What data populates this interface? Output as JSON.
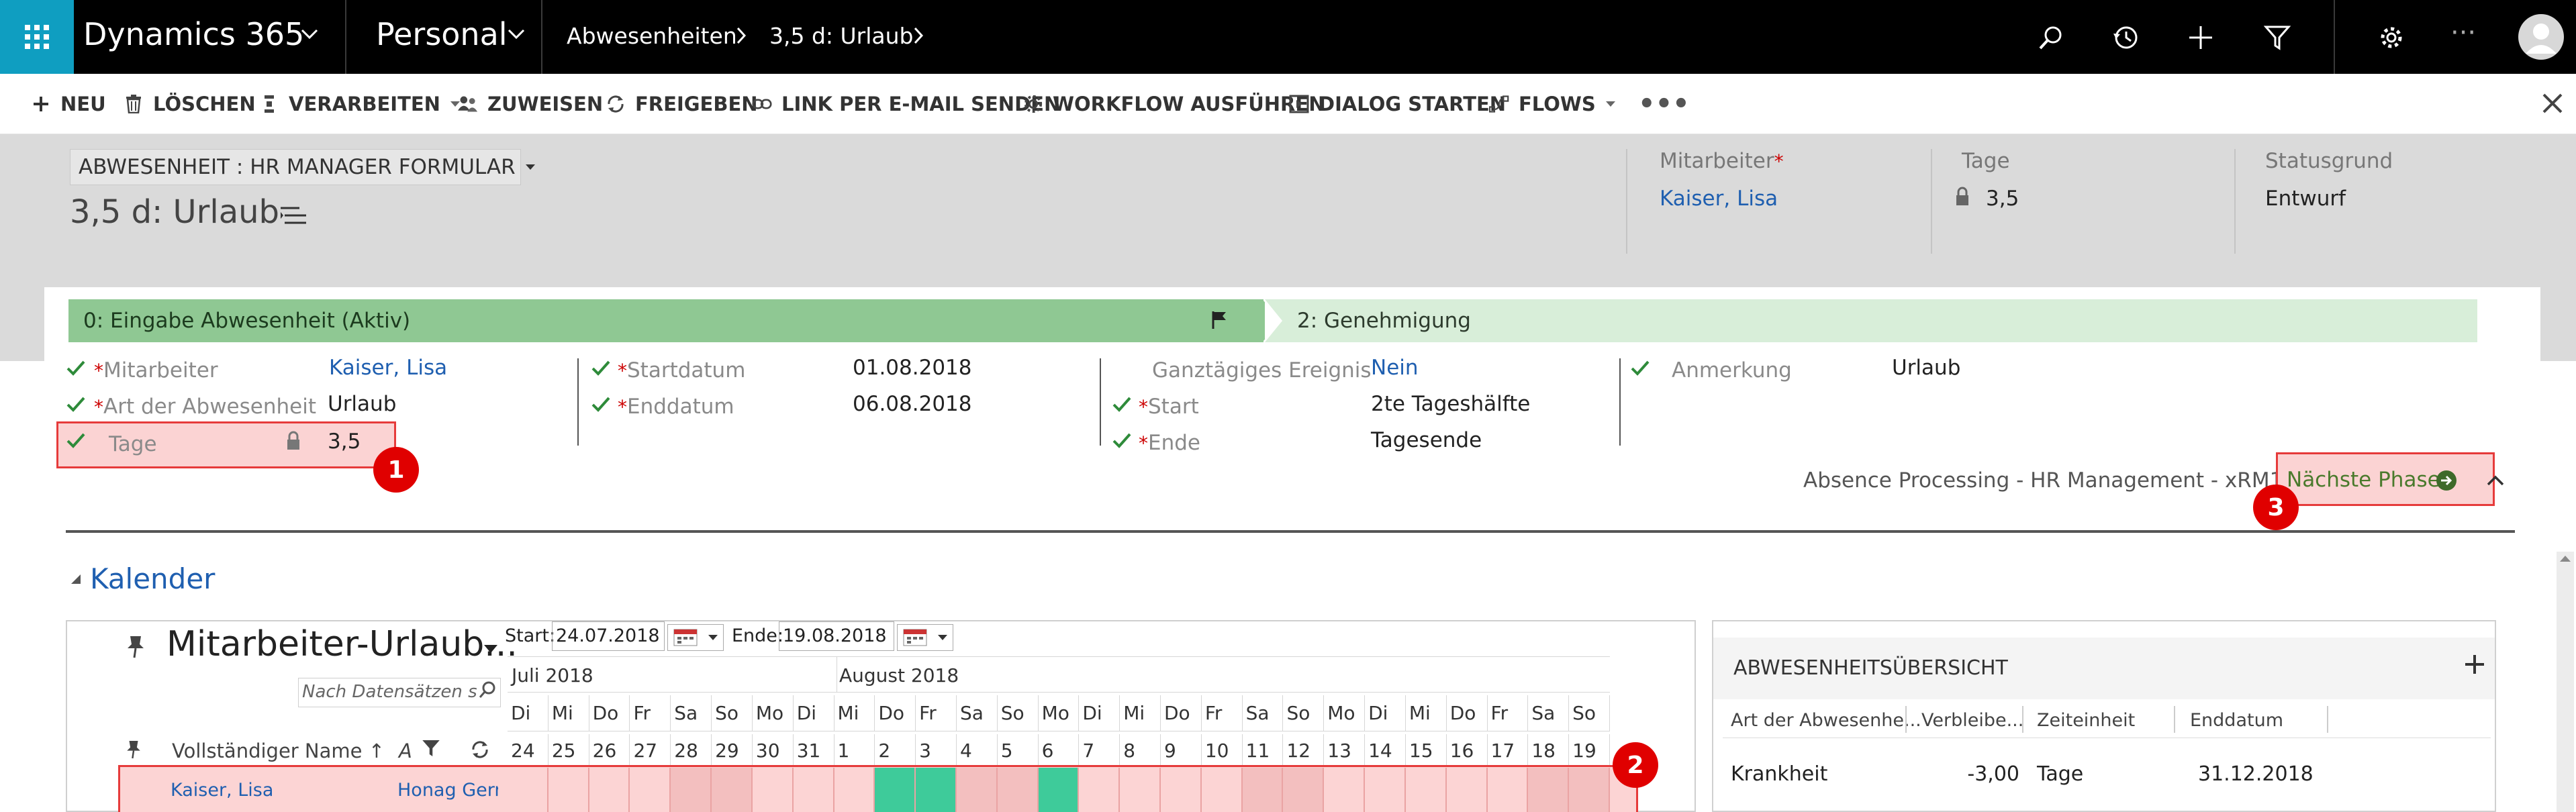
{
  "nav": {
    "app_name": "Dynamics 365",
    "area": "Personal",
    "breadcrumb": [
      "Abwesenheiten",
      "3,5 d: Urlaub"
    ],
    "icons": [
      "waffle-icon",
      "chevron-down-icon",
      "search-icon",
      "history-icon",
      "plus-icon",
      "filter-icon",
      "gear-icon",
      "more-icon",
      "avatar-icon"
    ]
  },
  "commands": [
    {
      "label": "NEU",
      "icon": "plus-icon"
    },
    {
      "label": "LÖSCHEN",
      "icon": "trash-icon"
    },
    {
      "label": "VERARBEITEN",
      "icon": "process-icon"
    },
    {
      "label": "ZUWEISEN",
      "icon": "assign-icon"
    },
    {
      "label": "FREIGEBEN",
      "icon": "share-icon"
    },
    {
      "label": "LINK PER E-MAIL SENDEN",
      "icon": "link-icon"
    },
    {
      "label": "WORKFLOW AUSFÜHREN",
      "icon": "workflow-icon"
    },
    {
      "label": "DIALOG STARTEN",
      "icon": "dialog-icon"
    },
    {
      "label": "FLOWS",
      "icon": "flow-icon"
    }
  ],
  "header": {
    "form_selector": "ABWESENHEIT : HR MANAGER FORMULAR",
    "record_title": "3,5 d: Urlaub",
    "fields": [
      {
        "label": "Mitarbeiter",
        "value": "Kaiser, Lisa",
        "required": "*"
      },
      {
        "label": "Tage",
        "value": "3,5"
      },
      {
        "label": "Statusgrund",
        "value": "Entwurf"
      }
    ]
  },
  "process": {
    "stage_active": "0: Eingabe Abwesenheit (Aktiv)",
    "stage_next": "2: Genehmigung",
    "col1": [
      {
        "label": "Mitarbeiter",
        "value": "Kaiser, Lisa"
      },
      {
        "label": "Art der Abwesenheit",
        "value": "Urlaub"
      },
      {
        "label": "Tage",
        "value": "3,5"
      }
    ],
    "col2": [
      {
        "label": "Startdatum",
        "value": "01.08.2018"
      },
      {
        "label": "Enddatum",
        "value": "06.08.2018"
      }
    ],
    "col3": [
      {
        "label": "Ganztägiges Ereignis",
        "value": "Nein"
      },
      {
        "label": "Start",
        "value": "2te Tageshälfte"
      },
      {
        "label": "Ende",
        "value": "Tagesende"
      }
    ],
    "col4": [
      {
        "label": "Anmerkung",
        "value": "Urlaub"
      }
    ],
    "process_name": "Absence Processing - HR Management - xRM1",
    "next_phase": "Nächste Phase",
    "badges": [
      "1",
      "2",
      "3"
    ]
  },
  "calendar": {
    "section_title": "Kalender",
    "view_title": "Mitarbeiter-Urlaub...",
    "search_placeholder": "Nach Datensätzen suchen",
    "start_label": "Start:",
    "start_value": "24.07.2018",
    "end_label": "Ende:",
    "end_value": "19.08.2018",
    "months": [
      "Juli 2018",
      "August 2018"
    ],
    "weekdays": [
      "Di",
      "Mi",
      "Do",
      "Fr",
      "Sa",
      "So",
      "Mo",
      "Di",
      "Mi",
      "Do",
      "Fr",
      "Sa",
      "So",
      "Mo",
      "Di",
      "Mi",
      "Do",
      "Fr",
      "Sa",
      "So",
      "Mo",
      "Di",
      "Mi",
      "Do",
      "Fr",
      "Sa",
      "So"
    ],
    "days": [
      "24",
      "25",
      "26",
      "27",
      "28",
      "29",
      "30",
      "31",
      "1",
      "2",
      "3",
      "4",
      "5",
      "6",
      "7",
      "8",
      "9",
      "10",
      "11",
      "12",
      "13",
      "14",
      "15",
      "16",
      "17",
      "18",
      "19"
    ],
    "absence_cells": [
      9,
      10,
      13
    ],
    "col_fullname": "Vollständiger Name ↑",
    "col_abbr": "A",
    "row": {
      "name": "Kaiser, Lisa",
      "company": "Honag Germ"
    }
  },
  "overview": {
    "title": "ABWESENHEITSÜBERSICHT",
    "columns": [
      "Art der Abwesenhe...",
      "Verbleibe...",
      "Zeiteinheit",
      "Enddatum"
    ],
    "rows": [
      {
        "art": "Krankheit",
        "verbleibend": "-3,00",
        "einheit": "Tage",
        "ende": "31.12.2018"
      }
    ]
  },
  "colors": {
    "accent_teal": "#0f9ec1",
    "stage_green": "#8fc893",
    "stage_light": "#d8eed9",
    "highlight_red": "#e63b3b",
    "absence_green": "#3ecb9a"
  }
}
